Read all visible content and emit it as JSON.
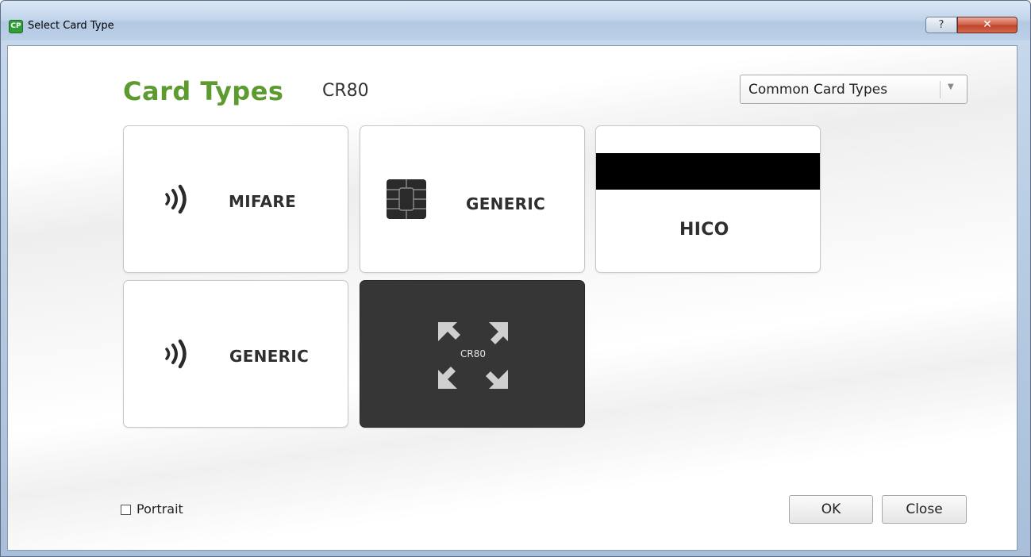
{
  "window": {
    "title": "Select Card Type",
    "help_label": "?",
    "close_label": "✕"
  },
  "header": {
    "title": "Card Types",
    "subtitle": "CR80"
  },
  "filter": {
    "selected": "Common Card Types"
  },
  "cards": [
    {
      "label": "MIFARE",
      "icon": "rfid-icon",
      "selected": false
    },
    {
      "label": "GENERIC",
      "icon": "chip-icon",
      "selected": false
    },
    {
      "label": "HICO",
      "icon": "magnetic-stripe",
      "selected": false
    },
    {
      "label": "GENERIC",
      "icon": "rfid-icon",
      "selected": false
    },
    {
      "label": "CR80",
      "icon": "card-size-icon",
      "selected": true
    }
  ],
  "options": {
    "portrait_label": "Portrait",
    "portrait_checked": false
  },
  "buttons": {
    "ok_label": "OK",
    "close_label": "Close"
  },
  "colors": {
    "heading_green": "#5d9a2f",
    "selected_card": "#363636"
  }
}
